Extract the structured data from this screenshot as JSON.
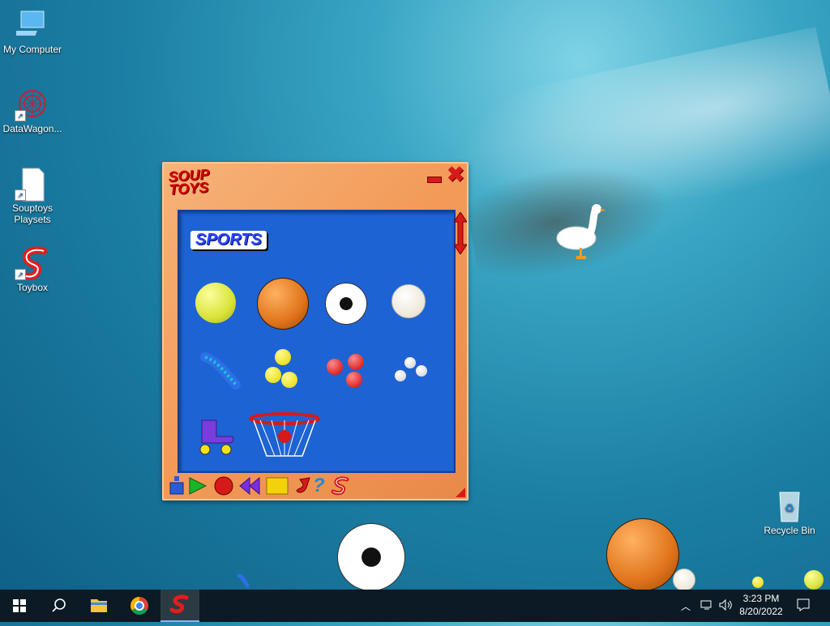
{
  "desktop": {
    "icons": [
      {
        "label": "My Computer"
      },
      {
        "label": "DataWagon..."
      },
      {
        "label": "Souptoys Playsets"
      },
      {
        "label": "Toybox"
      },
      {
        "label": "Recycle Bin"
      }
    ]
  },
  "soup_window": {
    "logo": "SOUP TOYS",
    "category": "SPORTS",
    "toys": [
      "tennis-ball",
      "basketball",
      "soccer-ball",
      "baseball",
      "slinky",
      "yellow-balls",
      "red-balls",
      "white-balls",
      "roller-skate",
      "basketball-hoop"
    ],
    "toolbar_icons": [
      "weight-icon",
      "play-icon",
      "record-icon",
      "rewind-icon",
      "stop-icon",
      "music-icon",
      "help-icon",
      "soup-logo-icon"
    ]
  },
  "taskbar": {
    "time": "3:23 PM",
    "date": "8/20/2022",
    "accent": "#8ab4f8"
  }
}
